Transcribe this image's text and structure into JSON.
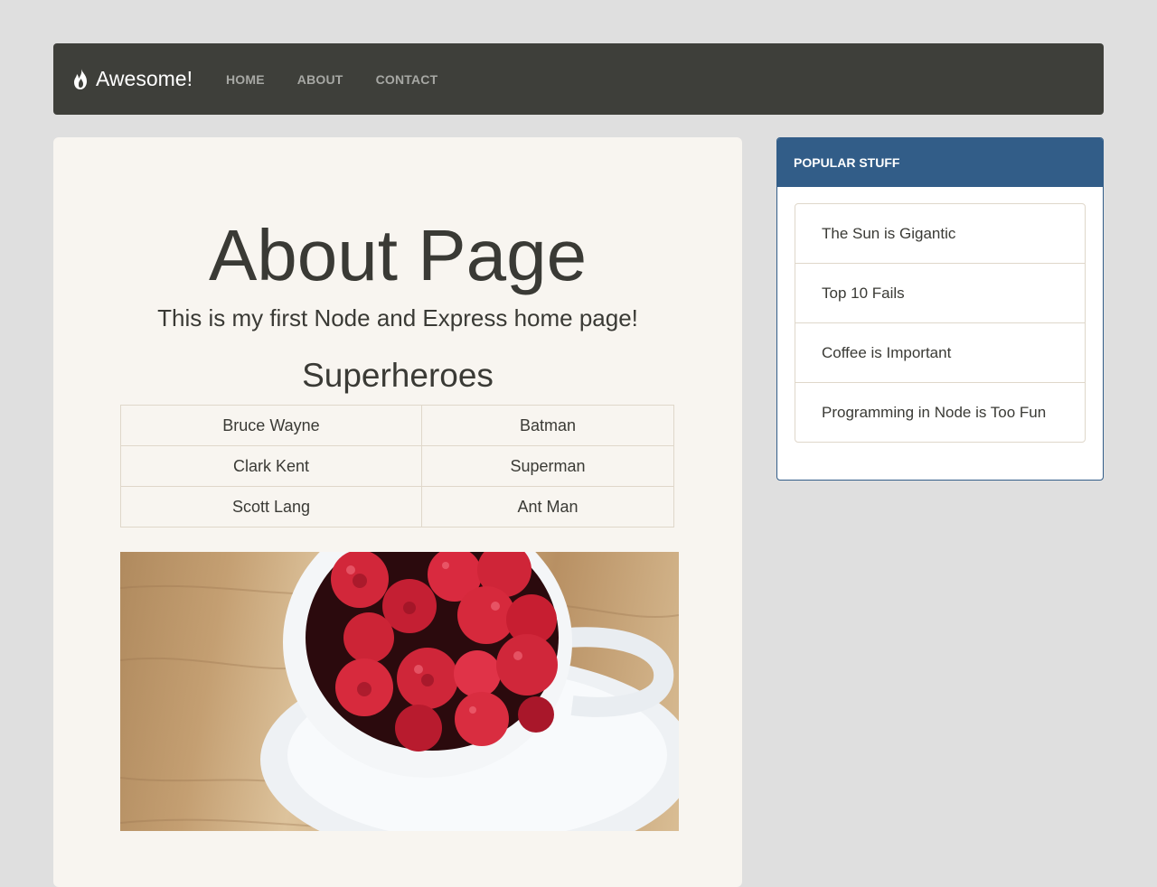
{
  "navbar": {
    "brand": "Awesome!",
    "links": [
      "HOME",
      "ABOUT",
      "CONTACT"
    ]
  },
  "main": {
    "title": "About Page",
    "tagline": "This is my first Node and Express home page!",
    "section_title": "Superheroes",
    "heroes": [
      {
        "name": "Bruce Wayne",
        "alias": "Batman"
      },
      {
        "name": "Clark Kent",
        "alias": "Superman"
      },
      {
        "name": "Scott Lang",
        "alias": "Ant Man"
      }
    ]
  },
  "sidebar": {
    "heading": "POPULAR STUFF",
    "items": [
      "The Sun is Gigantic",
      "Top 10 Fails",
      "Coffee is Important",
      "Programming in Node is Too Fun"
    ]
  },
  "colors": {
    "navbar_bg": "#3e3f3a",
    "panel_bg": "#f8f5f0",
    "sidebar_accent": "#325d88",
    "page_bg": "#dfdfdf"
  },
  "icons": {
    "brand_icon": "fire-icon"
  }
}
